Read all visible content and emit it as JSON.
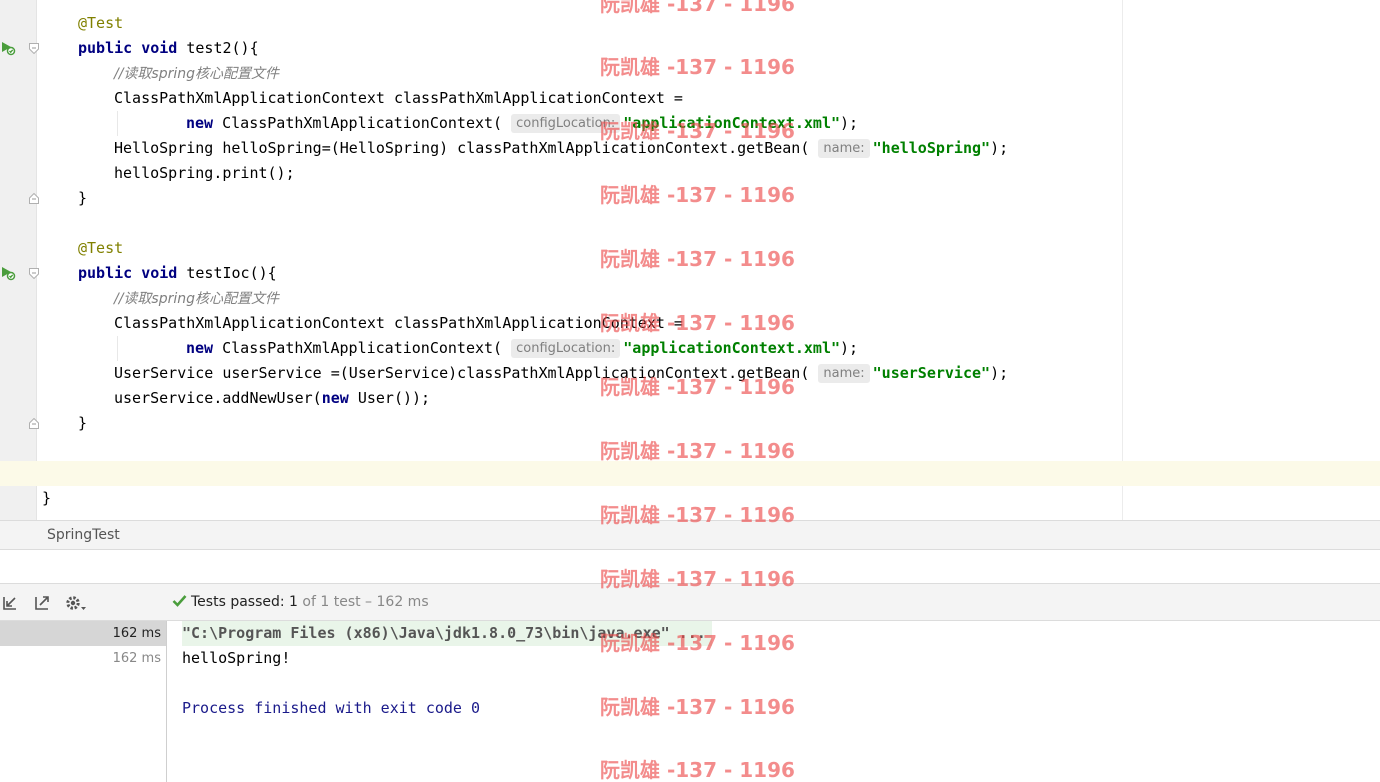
{
  "editor": {
    "lines": {
      "ann1": "@Test",
      "sig1_kw": "public void",
      "sig1_rest": " test2(){",
      "comment1": "//读取spring核心配置文件",
      "ctx_decl1": "ClassPathXmlApplicationContext classPathXmlApplicationContext =",
      "new_kw1": "new",
      "new_call1": " ClassPathXmlApplicationContext(",
      "hint_config1": "configLocation:",
      "xml_str1": "\"applicationContext.xml\"",
      "close1": ");",
      "getbean1_pre": "HelloSpring helloSpring=(HelloSpring) classPathXmlApplicationContext.getBean(",
      "hint_name1": "name:",
      "bean_str1": "\"helloSpring\"",
      "close2": ");",
      "print1": "helloSpring.print();",
      "brace1": "}",
      "ann2": "@Test",
      "sig2_kw": "public void",
      "sig2_rest": " testIoc(){",
      "comment2": "//读取spring核心配置文件",
      "ctx_decl2": "ClassPathXmlApplicationContext classPathXmlApplicationContext =",
      "new_kw2": "new",
      "new_call2": " ClassPathXmlApplicationContext(",
      "hint_config2": "configLocation:",
      "xml_str2": "\"applicationContext.xml\"",
      "close3": ");",
      "getbean2_pre": "UserService userService =(UserService)classPathXmlApplicationContext.getBean(",
      "hint_name2": "name:",
      "bean_str2": "\"userService\"",
      "close4": ");",
      "adduser_pre": "userService.addNewUser(",
      "new_kw3": "new",
      "adduser_post": " User());",
      "brace2": "}",
      "class_brace": "}"
    }
  },
  "watermark": "阮凯雄 -137 - 1196",
  "breadcrumb": {
    "label": "SpringTest"
  },
  "run_panel": {
    "status_label": "Tests passed:",
    "passed_count": "1",
    "status_suffix": "of 1 test – 162 ms",
    "tree": {
      "row1_time": "162 ms",
      "row2_time": "162 ms"
    },
    "console": {
      "command": "\"C:\\Program Files (x86)\\Java\\jdk1.8.0_73\\bin\\java.exe\" ...",
      "output": "helloSpring!",
      "exit": "Process finished with exit code 0"
    }
  },
  "colors": {
    "annotation": "#808000",
    "keyword": "#000080",
    "string": "#008000",
    "comment": "#808080",
    "pass": "#4a9d3c"
  }
}
